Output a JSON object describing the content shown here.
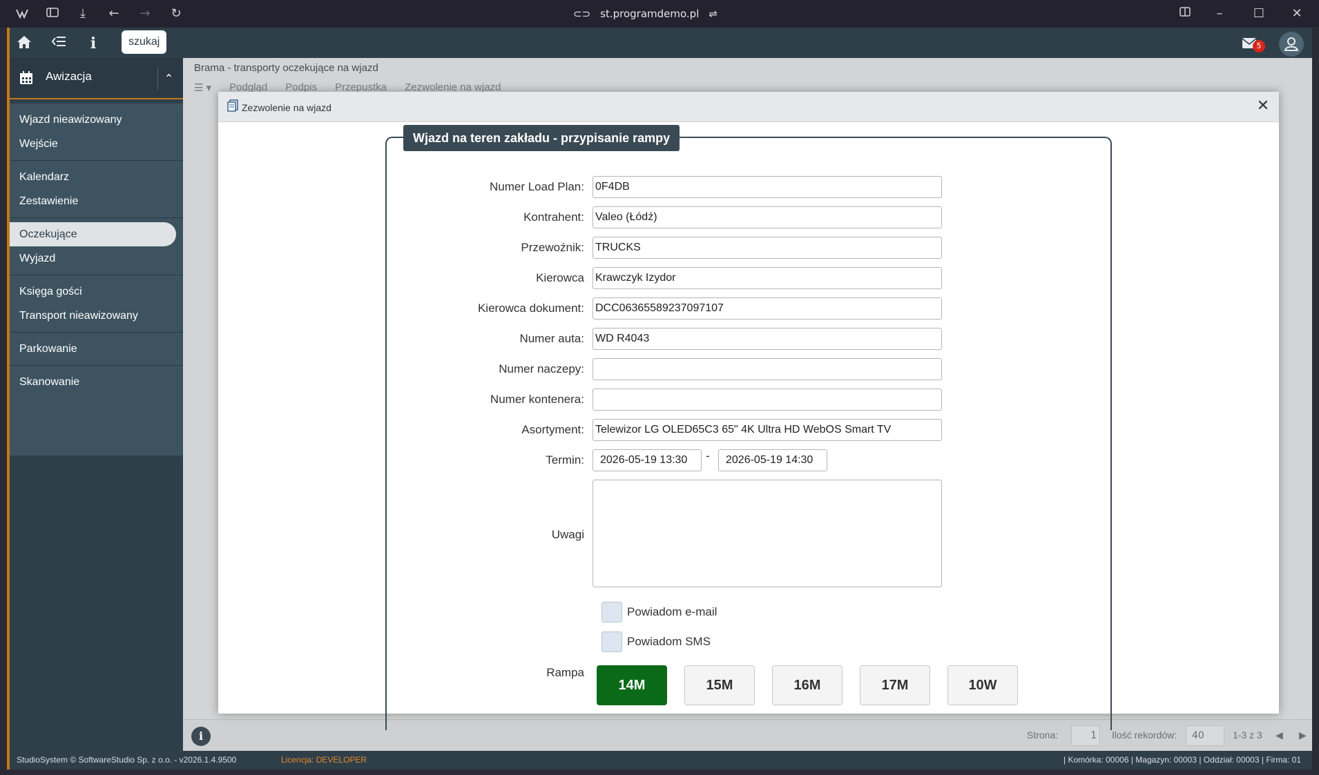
{
  "browser": {
    "url": "st.programdemo.pl"
  },
  "topbar": {
    "search_label": "szukaj",
    "mail_count": "5"
  },
  "sidebar": {
    "header": "Awizacja",
    "groups": [
      [
        "Wjazd nieawizowany",
        "Wejście"
      ],
      [
        "Kalendarz",
        "Zestawienie"
      ],
      [
        "Oczekujące",
        "Wyjazd"
      ],
      [
        "Księga gości",
        "Transport nieawizowany"
      ],
      [
        "Parkowanie"
      ],
      [
        "Skanowanie"
      ]
    ],
    "active_item": "Oczekujące"
  },
  "main": {
    "page_title": "Brama - transporty oczekujące na wjazd",
    "toolbar": [
      "Podgląd",
      "Podpis",
      "Przepustka",
      "Zezwolenie na wjazd"
    ]
  },
  "footer": {
    "page_label": "Strona:",
    "page_value": "1",
    "records_label": "Ilość rekordów:",
    "records_value": "40",
    "range": "1-3 z 3"
  },
  "statusbar": {
    "copyright": "StudioSystem © SoftwareStudio Sp. z o.o. - v2026.1.4.9500",
    "license_label": "Licencja:",
    "license_value": "DEVELOPER",
    "right": "| Komórka: 00006 | Magazyn: 00003 | Oddział: 00003 | Firma: 01"
  },
  "modal": {
    "title": "Zezwolenie na wjazd",
    "legend": "Wjazd na teren zakładu - przypisanie rampy",
    "fields": {
      "numer_load_plan": {
        "label": "Numer Load Plan:",
        "value": "0F4DB"
      },
      "kontrahent": {
        "label": "Kontrahent:",
        "value": "Valeo (Łódź)"
      },
      "przewoznik": {
        "label": "Przewoźnik:",
        "value": "TRUCKS"
      },
      "kierowca": {
        "label": "Kierowca",
        "value": "Krawczyk Izydor"
      },
      "kierowca_dokument": {
        "label": "Kierowca dokument:",
        "value": "DCC06365589237097107"
      },
      "numer_auta": {
        "label": "Numer auta:",
        "value": "WD R4043"
      },
      "numer_naczepy": {
        "label": "Numer naczepy:",
        "value": ""
      },
      "numer_kontenera": {
        "label": "Numer kontenera:",
        "value": ""
      },
      "asortyment": {
        "label": "Asortyment:",
        "value": "Telewizor LG OLED65C3 65\" 4K Ultra HD WebOS Smart TV"
      }
    },
    "termin": {
      "label": "Termin:",
      "from": "2026-05-19 13:30",
      "separator": "-",
      "to": "2026-05-19 14:30"
    },
    "uwagi": {
      "label": "Uwagi",
      "value": ""
    },
    "notify_email": "Powiadom e-mail",
    "notify_sms": "Powiadom SMS",
    "rampa": {
      "label": "Rampa",
      "options": [
        "14M",
        "15M",
        "16M",
        "17M",
        "10W"
      ],
      "selected": "14M"
    }
  }
}
